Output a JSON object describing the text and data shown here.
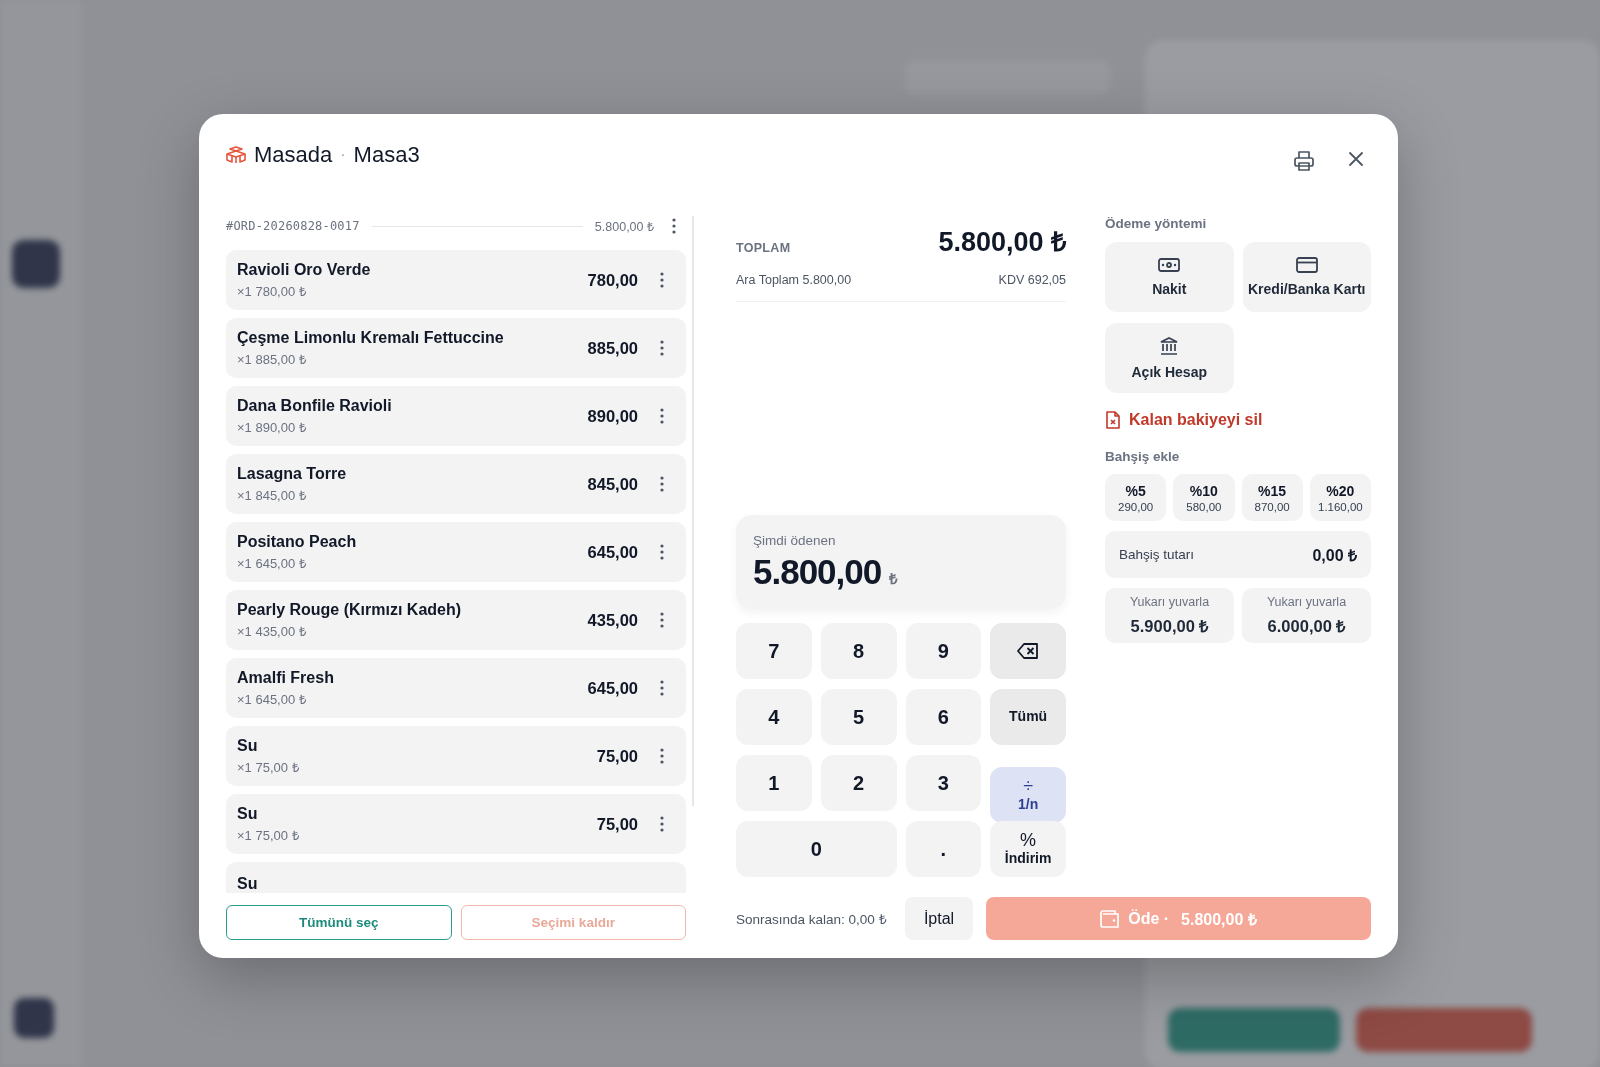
{
  "dialog": {
    "title": "Masada",
    "separator": "·",
    "subtitle": "Masa3"
  },
  "order": {
    "number": "#ORD-20260828-0017",
    "total": "5.800,00 ₺",
    "items": [
      {
        "name": "Ravioli Oro Verde",
        "detail": "×1 780,00 ₺",
        "price": "780,00"
      },
      {
        "name": "Çeşme Limonlu Kremalı Fettuccine",
        "detail": "×1 885,00 ₺",
        "price": "885,00"
      },
      {
        "name": "Dana Bonfile Ravioli",
        "detail": "×1 890,00 ₺",
        "price": "890,00"
      },
      {
        "name": "Lasagna Torre",
        "detail": "×1 845,00 ₺",
        "price": "845,00"
      },
      {
        "name": "Positano Peach",
        "detail": "×1 645,00 ₺",
        "price": "645,00"
      },
      {
        "name": "Pearly Rouge (Kırmızı Kadeh)",
        "detail": "×1 435,00 ₺",
        "price": "435,00"
      },
      {
        "name": "Amalfi Fresh",
        "detail": "×1 645,00 ₺",
        "price": "645,00"
      },
      {
        "name": "Su",
        "detail": "×1 75,00 ₺",
        "price": "75,00"
      },
      {
        "name": "Su",
        "detail": "×1 75,00 ₺",
        "price": "75,00"
      },
      {
        "name": "Su"
      }
    ]
  },
  "selection_buttons": [
    {
      "label": "Tümünü seç",
      "kind": "primary"
    },
    {
      "label": "Seçimi kaldır",
      "kind": "secondary"
    }
  ],
  "summary": {
    "total_label": "TOPLAM",
    "total": "5.800,00 ₺",
    "subtotal": "Ara Toplam 5.800,00",
    "tax": "KDV 692,05"
  },
  "paid_now": {
    "label": "Şimdi ödenen",
    "amount": "5.800,00",
    "currency": "₺"
  },
  "keypad": [
    {
      "kind": "digit",
      "label": "7",
      "selected": false
    },
    {
      "kind": "digit",
      "label": "8",
      "selected": false
    },
    {
      "kind": "digit",
      "label": "9",
      "selected": false
    },
    {
      "kind": "backspace",
      "selected": false
    },
    {
      "kind": "digit",
      "label": "4",
      "selected": false
    },
    {
      "kind": "digit",
      "label": "5",
      "selected": false
    },
    {
      "kind": "digit",
      "label": "6",
      "selected": false
    },
    {
      "kind": "text",
      "label": "Tümü",
      "selected": false
    },
    {
      "kind": "digit",
      "label": "1",
      "selected": false
    },
    {
      "kind": "digit",
      "label": "2",
      "selected": false
    },
    {
      "kind": "digit",
      "label": "3",
      "selected": false
    },
    {
      "kind": "symbol",
      "symbol": "÷",
      "label": "1/n",
      "selected": true
    },
    {
      "kind": "wide",
      "label": "0",
      "selected": false
    },
    {
      "kind": "digit",
      "label": ".",
      "selected": false
    },
    {
      "kind": "symbol",
      "symbol": "%",
      "label": "İndirim",
      "selected": false
    }
  ],
  "footer": {
    "remaining": "Sonrasında kalan: 0,00 ₺",
    "cancel": "İptal",
    "pay_label": "Öde ·",
    "pay_amount": "5.800,00 ₺"
  },
  "payment": {
    "heading": "Ödeme yöntemi",
    "methods": [
      {
        "label": "Nakit"
      },
      {
        "label": "Kredi/Banka Kartı"
      },
      {
        "label": "Açık Hesap"
      }
    ],
    "clear_balance": "Kalan bakiyeyi sil"
  },
  "tips": {
    "heading": "Bahşiş ekle",
    "presets": [
      {
        "percent": "%5",
        "amount": "290,00"
      },
      {
        "percent": "%10",
        "amount": "580,00"
      },
      {
        "percent": "%15",
        "amount": "870,00"
      },
      {
        "percent": "%20",
        "amount": "1.160,00"
      }
    ],
    "amount_label": "Bahşiş tutarı",
    "amount": "0,00 ₺",
    "round_up": [
      {
        "label": "Yukarı yuvarla",
        "amount": "5.900,00 ₺"
      },
      {
        "label": "Yukarı yuvarla",
        "amount": "6.000,00 ₺"
      }
    ]
  }
}
